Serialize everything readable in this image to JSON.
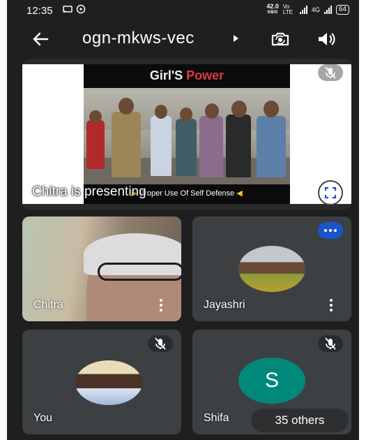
{
  "status_bar": {
    "time": "12:35",
    "speed_value": "42.0",
    "speed_unit": "KB/S",
    "network_1": "Vo LTE",
    "network_2": "4G",
    "battery": "64",
    "icons": [
      "cast-icon",
      "whatsapp-icon",
      "signal-icon",
      "battery-icon"
    ]
  },
  "top_bar": {
    "meeting_code": "ogn-mkws-vec",
    "icons": [
      "back-arrow-icon",
      "caret-right-icon",
      "switch-camera-icon",
      "speaker-icon"
    ]
  },
  "presentation": {
    "slide_title_1": "Girl'S",
    "slide_title_2": "Power",
    "slide_caption": "Proper Use Of Self Defense",
    "presenter_label": "Chitra is presenting",
    "icons": [
      "mic-off-icon",
      "fullscreen-icon"
    ]
  },
  "participants": [
    {
      "name": "Chitra",
      "state": "video",
      "icon": "more-vert-icon"
    },
    {
      "name": "Jayashri",
      "state": "speaking",
      "icon": "more-vert-icon"
    },
    {
      "name": "You",
      "state": "muted",
      "icon": "mic-off-icon"
    },
    {
      "name": "Shifa",
      "state": "muted",
      "initial": "S",
      "icon": "mic-off-icon"
    }
  ],
  "others_chip": "35 others",
  "colors": {
    "background": "#1f1f1f",
    "tile": "#3c4043",
    "speaking_badge": "#1a56c9",
    "avatar_shifa": "#00897b",
    "title_accent": "#e23a3a"
  }
}
